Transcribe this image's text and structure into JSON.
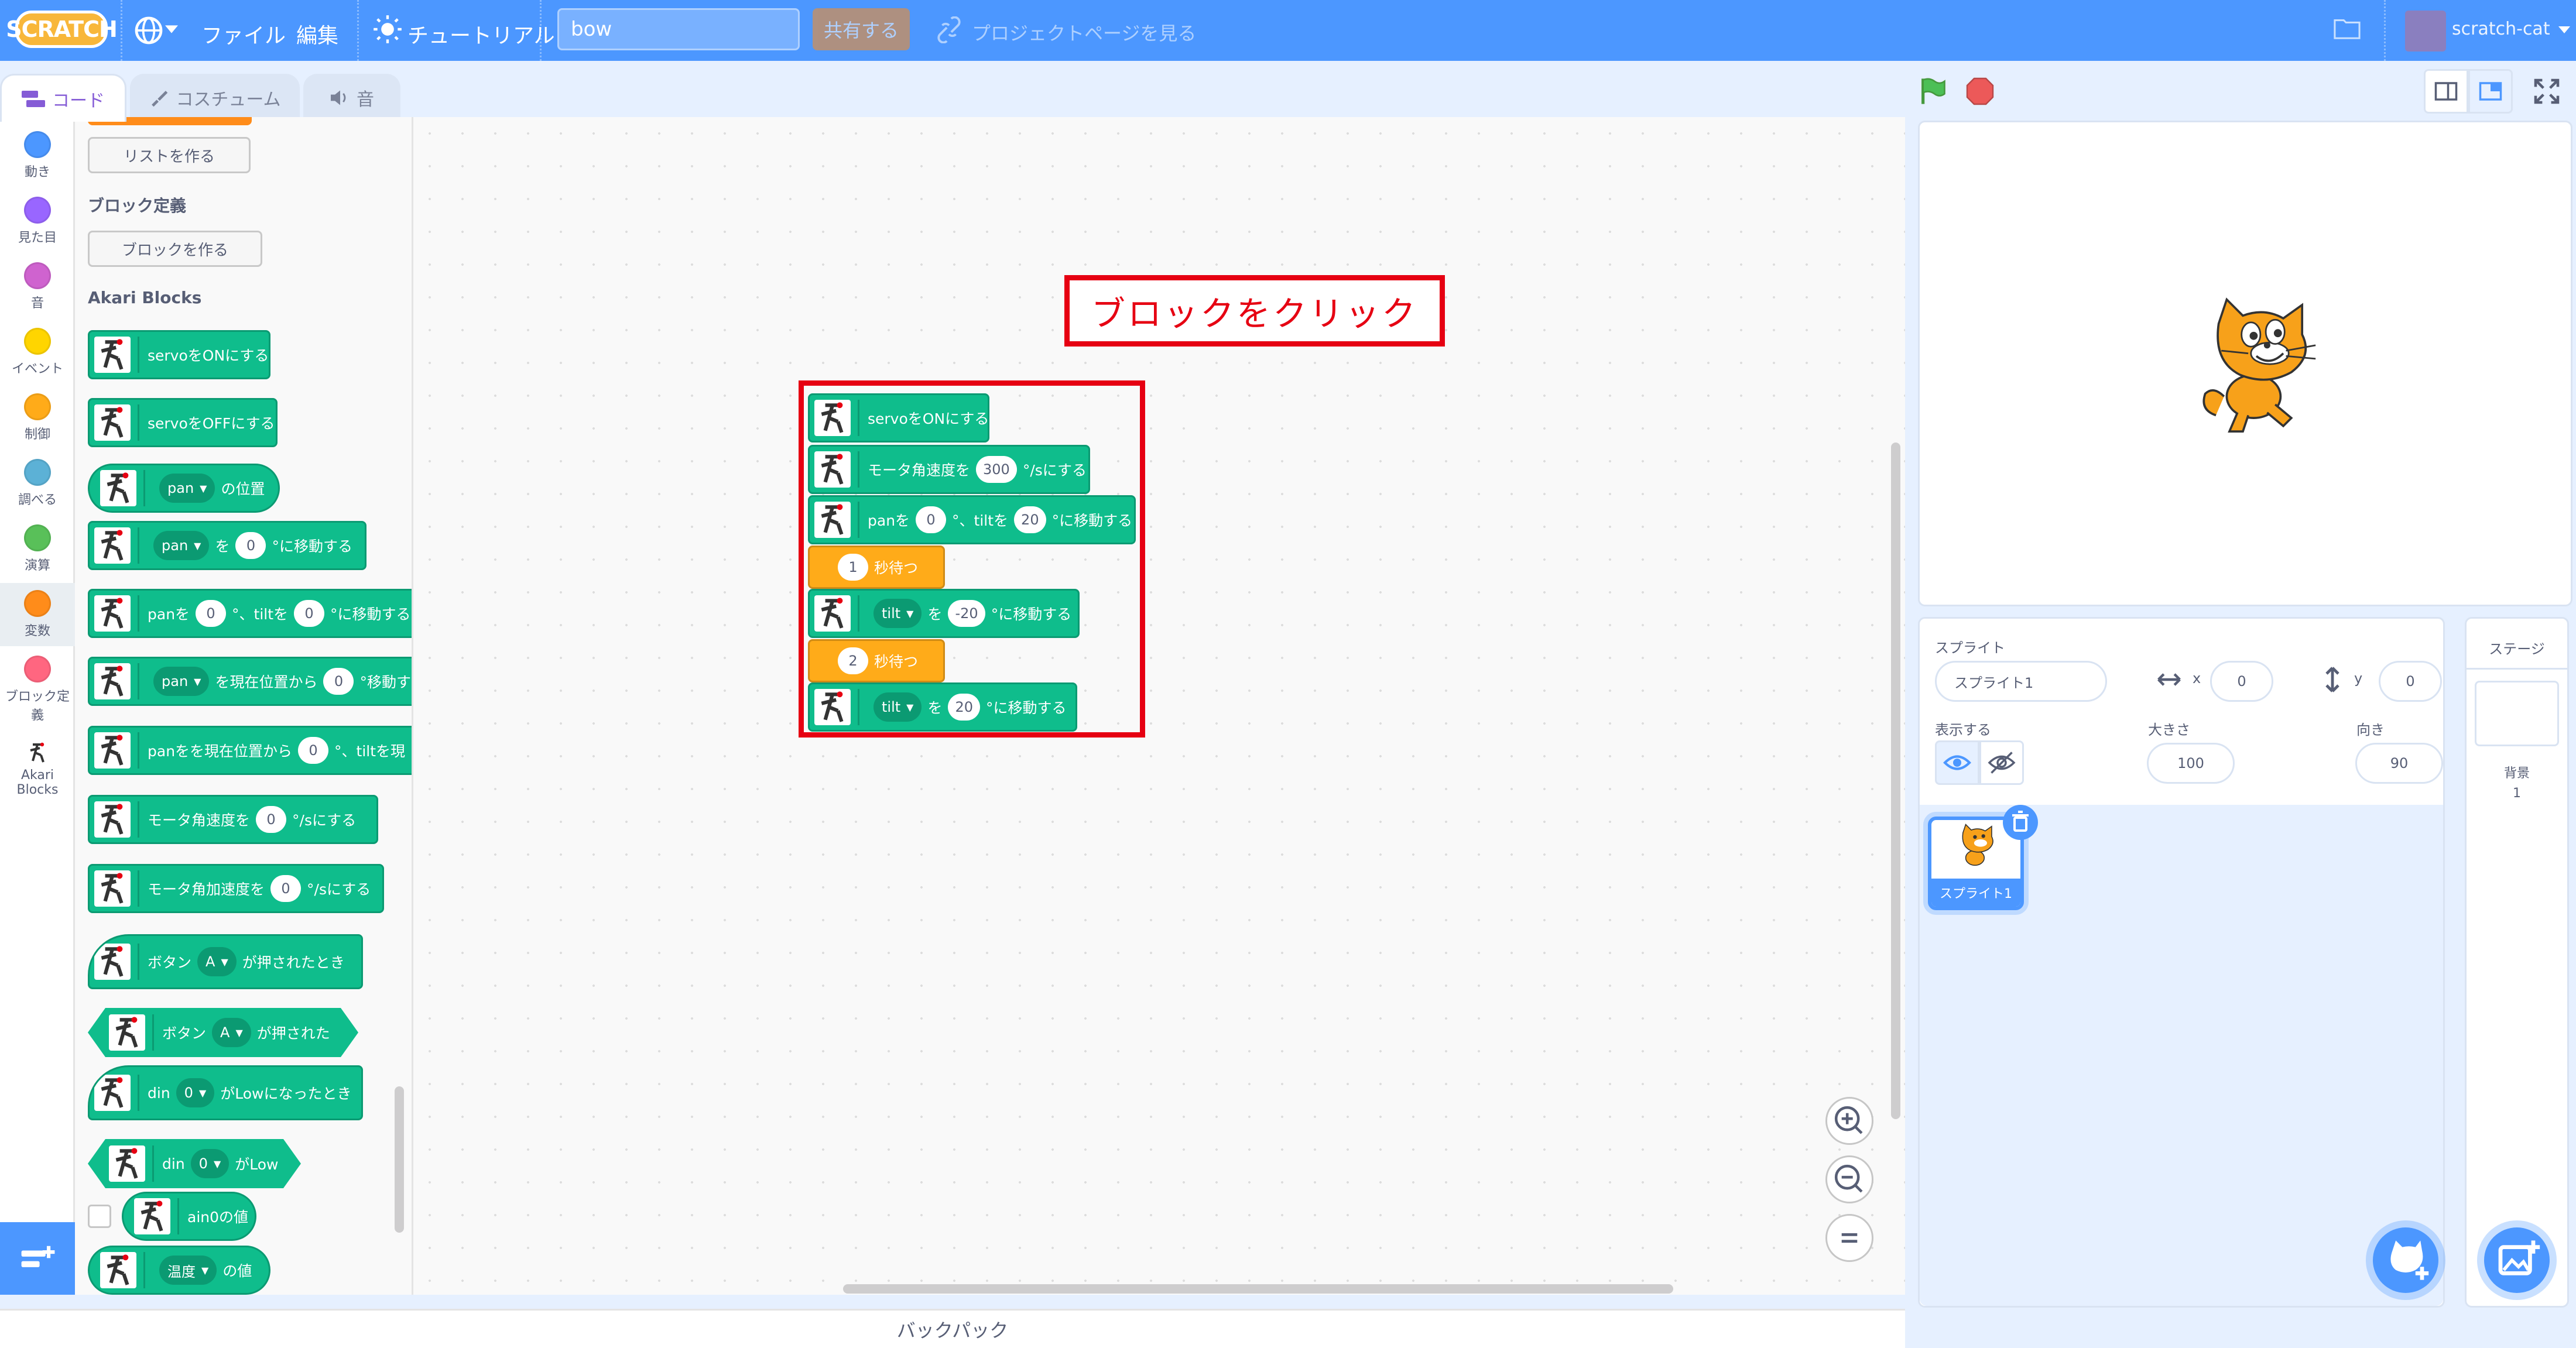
{
  "menubar": {
    "logo": "SCRATCH",
    "file_label": "ファイル",
    "edit_label": "編集",
    "tutorials_label": "チュートリアル",
    "project_title": "bow",
    "share_label": "共有する",
    "see_project_page_label": "プロジェクトページを見る",
    "username": "scratch-cat"
  },
  "tabs": {
    "code": "コード",
    "costumes": "コスチューム",
    "sounds": "音"
  },
  "categories": [
    {
      "label": "動き",
      "color": "#4c97ff"
    },
    {
      "label": "見た目",
      "color": "#9966ff"
    },
    {
      "label": "音",
      "color": "#cf63cf"
    },
    {
      "label": "イベント",
      "color": "#ffd500"
    },
    {
      "label": "制御",
      "color": "#ffab19"
    },
    {
      "label": "調べる",
      "color": "#5cb1d6"
    },
    {
      "label": "演算",
      "color": "#59c059"
    },
    {
      "label": "変数",
      "color": "#ff8c1a"
    },
    {
      "label": "ブロック定義",
      "color": "#ff6680"
    },
    {
      "label": "Akari Blocks",
      "color": ""
    }
  ],
  "palette": {
    "make_list": "リストを作る",
    "my_blocks_heading": "ブロック定義",
    "make_block": "ブロックを作る",
    "akari_heading": "Akari Blocks",
    "servo_on": "servoをONにする",
    "servo_off": "servoをOFFにする",
    "pan_value": {
      "dropdown": "pan",
      "suffix": "の位置"
    },
    "move_axis": {
      "dropdown": "pan",
      "prefix": "を",
      "value": "0",
      "suffix": "°に移動する"
    },
    "move_both": {
      "prefix": "panを",
      "value1": "0",
      "mid": "°、tiltを",
      "value2": "0",
      "suffix": "°に移動する"
    },
    "move_rel": {
      "dropdown": "pan",
      "prefix": "を現在位置から",
      "value": "0",
      "suffix": "°移動する"
    },
    "move_rel_both": {
      "prefix": "panをを現在位置から",
      "value": "0",
      "suffix": "°、tiltを現"
    },
    "speed": {
      "prefix": "モータ角速度を",
      "value": "0",
      "suffix": "°/sにする"
    },
    "accel": {
      "prefix": "モータ角加速度を",
      "value": "0",
      "suffix": "°/sにする"
    },
    "button_hat": {
      "prefix": "ボタン",
      "dropdown": "A",
      "suffix": "が押されたとき"
    },
    "button_bool": {
      "prefix": "ボタン",
      "dropdown": "A",
      "suffix": "が押された"
    },
    "din_hat": {
      "prefix": "din",
      "dropdown": "0",
      "suffix": "がLowになったとき"
    },
    "din_bool": {
      "prefix": "din",
      "dropdown": "0",
      "suffix": "がLow"
    },
    "ain_label": "ain0の値",
    "temp": {
      "dropdown": "温度",
      "suffix": "の値"
    }
  },
  "script": {
    "servo_on": "servoをONにする",
    "speed": {
      "prefix": "モータ角速度を",
      "value": "300",
      "suffix": "°/sにする"
    },
    "move_both": {
      "prefix": "panを",
      "value1": "0",
      "mid": "°、tiltを",
      "value2": "20",
      "suffix": "°に移動する"
    },
    "wait1": {
      "value": "1",
      "suffix": "秒待つ"
    },
    "move_tilt1": {
      "dropdown": "tilt",
      "prefix": "を",
      "value": "-20",
      "suffix": "°に移動する"
    },
    "wait2": {
      "value": "2",
      "suffix": "秒待つ"
    },
    "move_tilt2": {
      "dropdown": "tilt",
      "prefix": "を",
      "value": "20",
      "suffix": "°に移動する"
    }
  },
  "annotation": "ブロックをクリック",
  "backpack": "バックパック",
  "sprite_info": {
    "sprite_label": "スプライト",
    "sprite_name": "スプライト1",
    "x_label": "x",
    "x": "0",
    "y_label": "y",
    "y": "0",
    "show_label": "表示する",
    "size_label": "大きさ",
    "size": "100",
    "direction_label": "向き",
    "direction": "90"
  },
  "sprite_list": [
    {
      "name": "スプライト1",
      "selected": true
    }
  ],
  "stage_panel": {
    "title": "ステージ",
    "backdrops_label": "背景",
    "backdrops_count": "1"
  },
  "colors": {
    "accent": "#4c97ff",
    "akari_green": "#0fbd8c",
    "control_orange": "#ffab19",
    "annotation_red": "#e60012"
  }
}
